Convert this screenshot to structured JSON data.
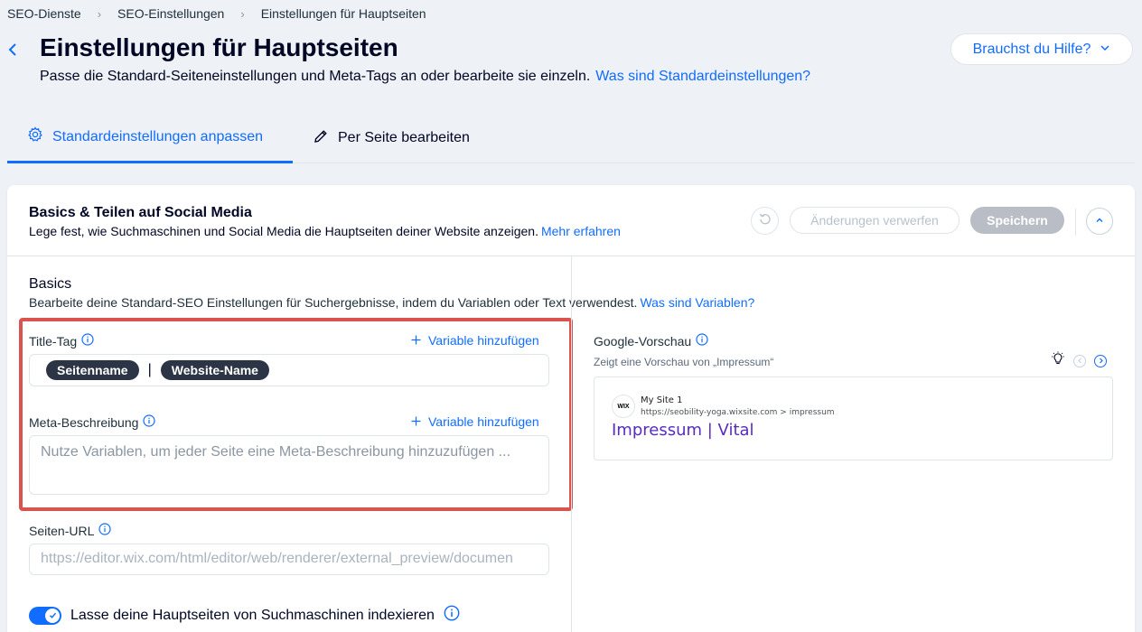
{
  "breadcrumb": {
    "items": [
      "SEO-Dienste",
      "SEO-Einstellungen",
      "Einstellungen für Hauptseiten"
    ]
  },
  "header": {
    "title": "Einstellungen für Hauptseiten",
    "subtitle": "Passe die Standard-Seiteneinstellungen und Meta-Tags an oder bearbeite sie einzeln.",
    "subtitle_link": "Was sind Standardeinstellungen?",
    "help_button": "Brauchst du Hilfe?"
  },
  "tabs": [
    {
      "label": "Standardeinstellungen anpassen",
      "icon": "gear-icon",
      "active": true
    },
    {
      "label": "Per Seite bearbeiten",
      "icon": "pencil-icon",
      "active": false
    }
  ],
  "card": {
    "title": "Basics & Teilen auf Social Media",
    "subtitle": "Lege fest, wie Suchmaschinen und Social Media die Hauptseiten deiner Website anzeigen.",
    "subtitle_link": "Mehr erfahren",
    "discard_button": "Änderungen verwerfen",
    "save_button": "Speichern"
  },
  "basics": {
    "title": "Basics",
    "subtitle": "Bearbeite deine Standard-SEO Einstellungen für Suchergebnisse, indem du Variablen oder Text verwendest.",
    "subtitle_link": "Was sind Variablen?"
  },
  "title_tag": {
    "label": "Title-Tag",
    "add_variable": "Variable hinzufügen",
    "chips": [
      "Seitenname",
      "Website-Name"
    ],
    "separator": "|"
  },
  "meta_description": {
    "label": "Meta-Beschreibung",
    "add_variable": "Variable hinzufügen",
    "placeholder": "Nutze Variablen, um jeder Seite eine Meta-Beschreibung hinzuzufügen ..."
  },
  "page_url": {
    "label": "Seiten-URL",
    "value": "https://editor.wix.com/html/editor/web/renderer/external_preview/documen"
  },
  "indexing": {
    "label": "Lasse deine Hauptseiten von Suchmaschinen indexieren",
    "enabled": true
  },
  "google_preview": {
    "label": "Google-Vorschau",
    "subtitle": "Zeigt eine Vorschau von „Impressum“",
    "logo_text": "WIX",
    "site_name": "My Site 1",
    "url": "https://seobility-yoga.wixsite.com > impressum",
    "result_title": "Impressum | Vital"
  },
  "colors": {
    "accent": "#116dff",
    "highlight_border": "#d9534f",
    "chip_bg": "#2b3545",
    "save_disabled": "#b9bdc6",
    "preview_title": "#5a2bbf"
  }
}
